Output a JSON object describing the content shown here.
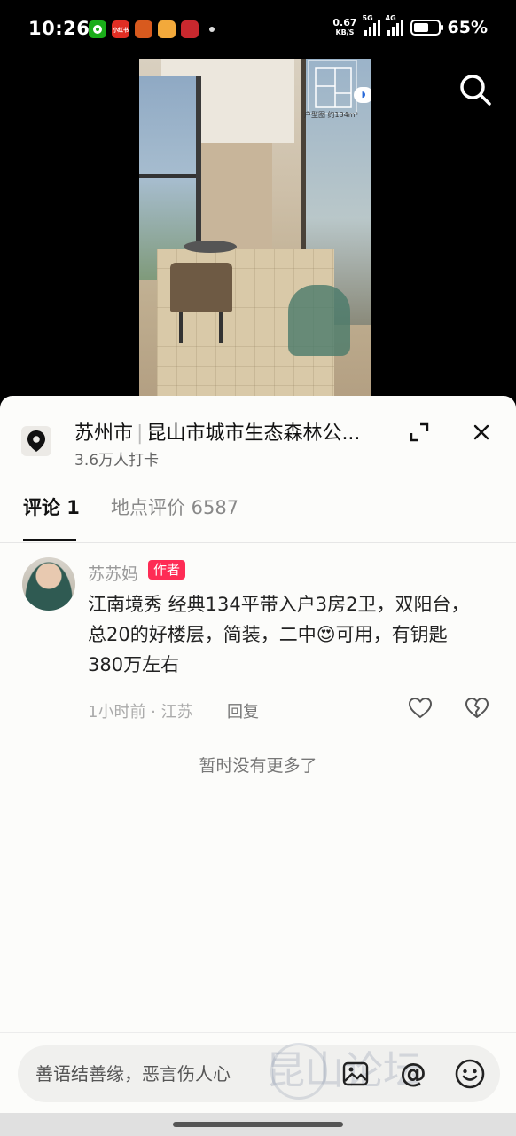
{
  "status_bar": {
    "time": "10:26",
    "net_speed": "0.67",
    "net_unit": "KB/S",
    "sig1_label": "5G",
    "sig2_label": "4G",
    "battery_pct": "65%",
    "battery_level": 0.65,
    "app_icons": [
      {
        "name": "wechat-like",
        "color": "#1aad19",
        "text": ""
      },
      {
        "name": "xiaohongshu",
        "color": "#e02e24",
        "text": "小红书"
      },
      {
        "name": "app-orange",
        "color": "#d85a1e",
        "text": ""
      },
      {
        "name": "app-yellow",
        "color": "#f2a93b",
        "text": ""
      },
      {
        "name": "app-red",
        "color": "#c8282e",
        "text": ""
      }
    ]
  },
  "video": {
    "floorplan_label": "户型图 约134m²"
  },
  "location": {
    "city": "苏州市",
    "place": "昆山市城市生态森林公...",
    "checkins": "3.6万人打卡"
  },
  "tabs": {
    "comments": "评论 1",
    "reviews": "地点评价 6587"
  },
  "comment": {
    "author": "苏苏妈",
    "author_tag": "作者",
    "text_part1": "江南境秀 经典134平带入户3房2卫，双阳台，总20的好楼层，简装，二中",
    "emoji": "😍",
    "text_part2": "可用，有钥匙 380万左右",
    "meta": "1小时前 · 江苏",
    "reply": "回复"
  },
  "no_more": "暂时没有更多了",
  "input": {
    "placeholder": "善语结善缘，恶言伤人心",
    "at_symbol": "@",
    "watermark": "昆山论坛"
  },
  "colors": {
    "accent": "#fe2c55",
    "sheet_bg": "#fcfcfa"
  }
}
